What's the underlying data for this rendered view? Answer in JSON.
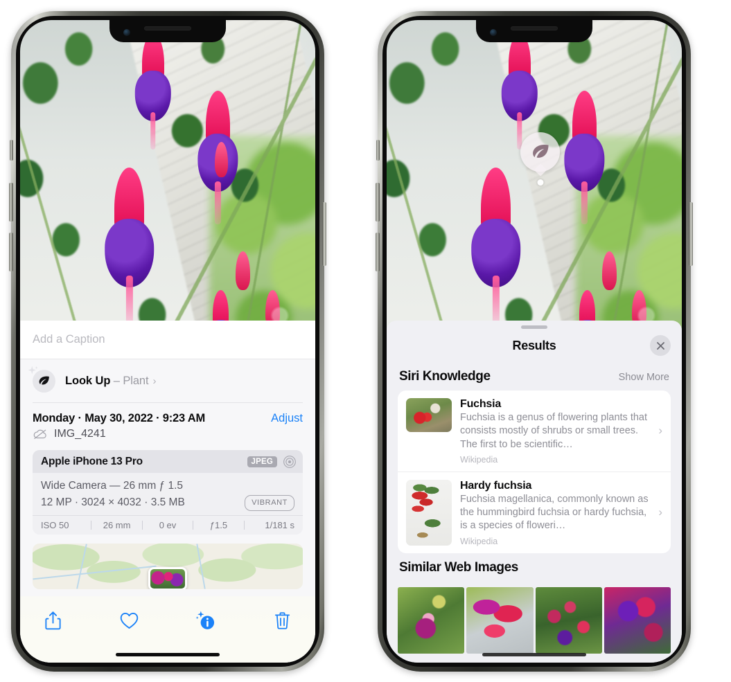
{
  "left_phone": {
    "name": "iPhone photo detail view",
    "caption_field": {
      "placeholder": "Add a Caption",
      "value": ""
    },
    "look_up": {
      "label": "Look Up",
      "dash": " – ",
      "subject": "Plant",
      "chevron": "›",
      "icon": "leaf-icon"
    },
    "capture": {
      "date_line": "Monday · May 30, 2022 · 9:23 AM",
      "adjust_label": "Adjust",
      "filename": "IMG_4241",
      "icloud_icon": "cloud-slash-icon"
    },
    "exif": {
      "device": "Apple iPhone 13 Pro",
      "format_badge": "JPEG",
      "lens_icon": "aperture-icon",
      "lens_line": "Wide Camera — 26 mm ƒ 1.5",
      "size_line": "12 MP · 3024 × 4032 · 3.5 MB",
      "style_badge": "VIBRANT",
      "stats": [
        "ISO 50",
        "26 mm",
        "0 ev",
        "ƒ1.5",
        "1/181 s"
      ]
    },
    "map": {
      "name": "location-map-strip",
      "pin": "photo-pin"
    },
    "toolbar": {
      "share": "share-icon",
      "favorite": "heart-icon",
      "info": "info-sparkle-icon",
      "delete": "trash-icon"
    }
  },
  "right_phone": {
    "name": "Visual Look Up results view",
    "pin": {
      "icon": "leaf-icon",
      "label": "plant-lookup-pin"
    },
    "sheet": {
      "title": "Results",
      "close_icon": "close-icon",
      "grabber": "drag-handle"
    },
    "siri_knowledge": {
      "title": "Siri Knowledge",
      "action": "Show More",
      "cards": [
        {
          "title": "Fuchsia",
          "description": "Fuchsia is a genus of flowering plants that consists mostly of shrubs or small trees. The first to be scientific…",
          "source": "Wikipedia",
          "chevron": "›"
        },
        {
          "title": "Hardy fuchsia",
          "description": "Fuchsia magellanica, commonly known as the hummingbird fuchsia or hardy fuchsia, is a species of floweri…",
          "source": "Wikipedia",
          "chevron": "›"
        }
      ]
    },
    "similar_web_images": {
      "title": "Similar Web Images",
      "count": 4
    }
  },
  "colors": {
    "accent_blue": "#1b82f8",
    "sheet_bg_left": "#f7f7f9",
    "sheet_bg_right": "#f0f0f4",
    "card_white": "#ffffff",
    "secondary_text": "#8e8e96",
    "badge_gray": "#a9a9b1"
  }
}
